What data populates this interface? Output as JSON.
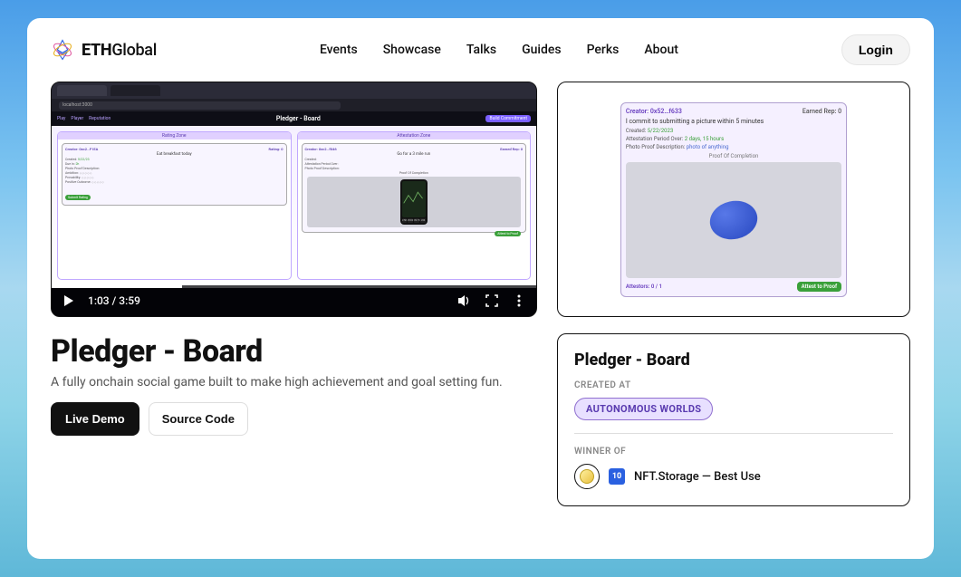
{
  "brand": {
    "bold": "ETH",
    "light": "Global"
  },
  "nav": [
    "Events",
    "Showcase",
    "Talks",
    "Guides",
    "Perks",
    "About"
  ],
  "login": "Login",
  "video": {
    "url_label": "localhost:3000",
    "app_title": "Pledger - Board",
    "build_label": "Build Commitment",
    "zone_left": "Rating Zone",
    "zone_right": "Attestation Zone",
    "card_left": {
      "creator": "Creator: 0xc2…F1EA",
      "rating": "Rating: 0",
      "title": "Eat breakfast today",
      "created": "Created:",
      "due": "Due in:",
      "proof_desc": "Photo Proof Description:",
      "ambition": "Ambition:",
      "provability": "Provability:",
      "positive": "Positive Outcome:",
      "submit": "Submit Rating"
    },
    "card_right": {
      "creator": "Creator: 0xc2…f046",
      "rep": "Earned Rep: 0",
      "title": "Go for a 3 mile run",
      "created": "Created:",
      "att_over": "Attestation Period Over:",
      "proof_desc": "Photo Proof Description:",
      "proof_label": "Proof Of Completion",
      "stats": [
        "2:58",
        "25:02",
        "09:15",
        "234"
      ],
      "attest": "Attest to Proof"
    },
    "time": "1:03 / 3:59"
  },
  "project": {
    "title": "Pledger - Board",
    "tagline": "A fully onchain social game built to make high achievement and goal setting fun.",
    "live_demo": "Live Demo",
    "source_code": "Source Code"
  },
  "thumbnail": {
    "creator": "Creator: 0x52…f633",
    "rep": "Earned Rep: 0",
    "commit": "I commit to submitting a picture within 5 minutes",
    "created_label": "Created:",
    "created_val": "5/22/2023",
    "att_label": "Attestation Period Over:",
    "att_val": "2 days, 15 hours",
    "proof_desc_label": "Photo Proof Description:",
    "proof_desc_val": "photo of anything",
    "proof_label": "Proof Of Completion",
    "attestors": "Attestors: 0 / 1",
    "attest_btn": "Attest to Proof"
  },
  "info": {
    "title": "Pledger - Board",
    "created_at": "CREATED AT",
    "event": "AUTONOMOUS WORLDS",
    "winner_of": "WINNER OF",
    "winner_badge": "10",
    "winner_text": "NFT.Storage — Best Use"
  }
}
